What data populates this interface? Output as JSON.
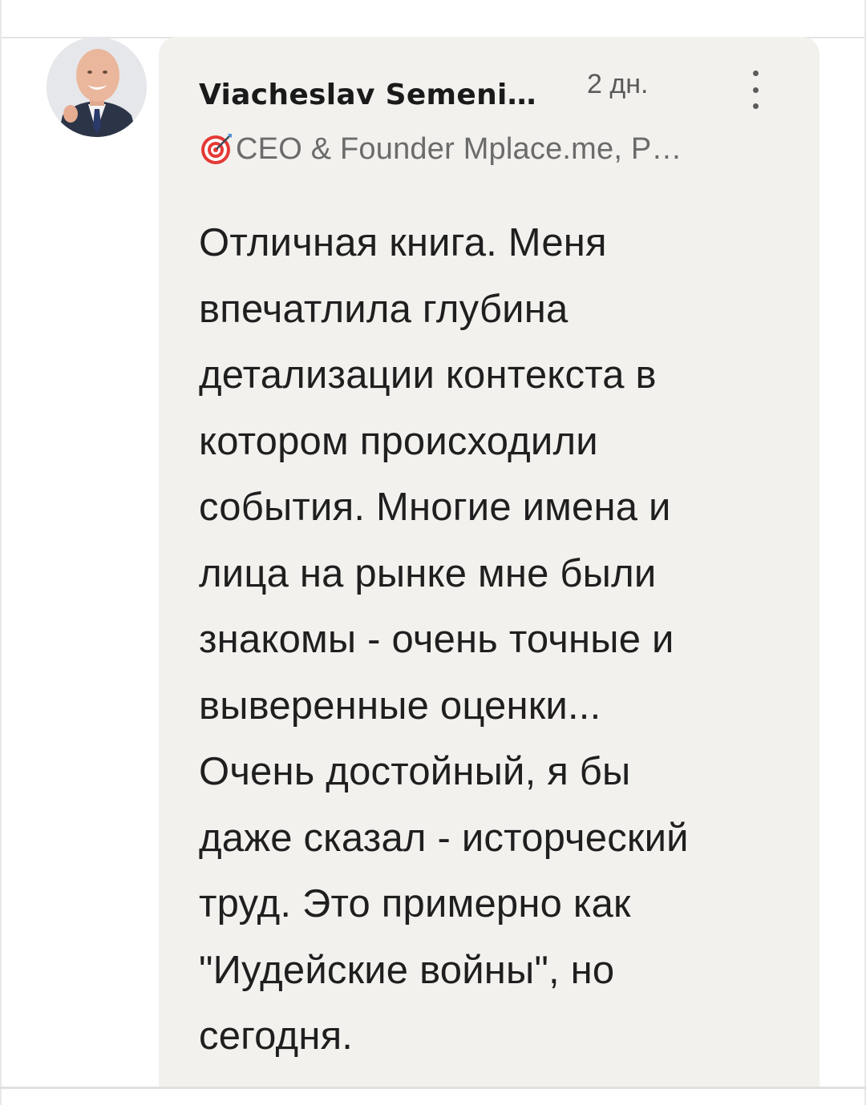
{
  "comment": {
    "author_name": "Viacheslav Semeni…",
    "time_ago": "2 дн.",
    "author_headline": "CEO & Founder Mplace.me, P…",
    "headline_icon": "direct-hit-target-icon",
    "more_icon": "vertical-ellipsis-icon",
    "text_lines": [
      "Отличная книга. Меня",
      "впечатлила глубина",
      "детализации контекста в",
      "котором происходили",
      "события. Многие имена и",
      "лица на рынке мне были",
      "знакомы - очень точные и",
      "выверенные оценки...",
      "Очень достойный, я бы",
      "даже сказал - исторческий",
      "труд. Это примерно как",
      "\"Иудейские войны\", но",
      "сегодня."
    ]
  },
  "colors": {
    "bubble_background": "#f2f1ee",
    "text_primary": "#1f1f1f",
    "text_secondary": "#6b6b6b",
    "target_icon_red": "#e53935"
  }
}
